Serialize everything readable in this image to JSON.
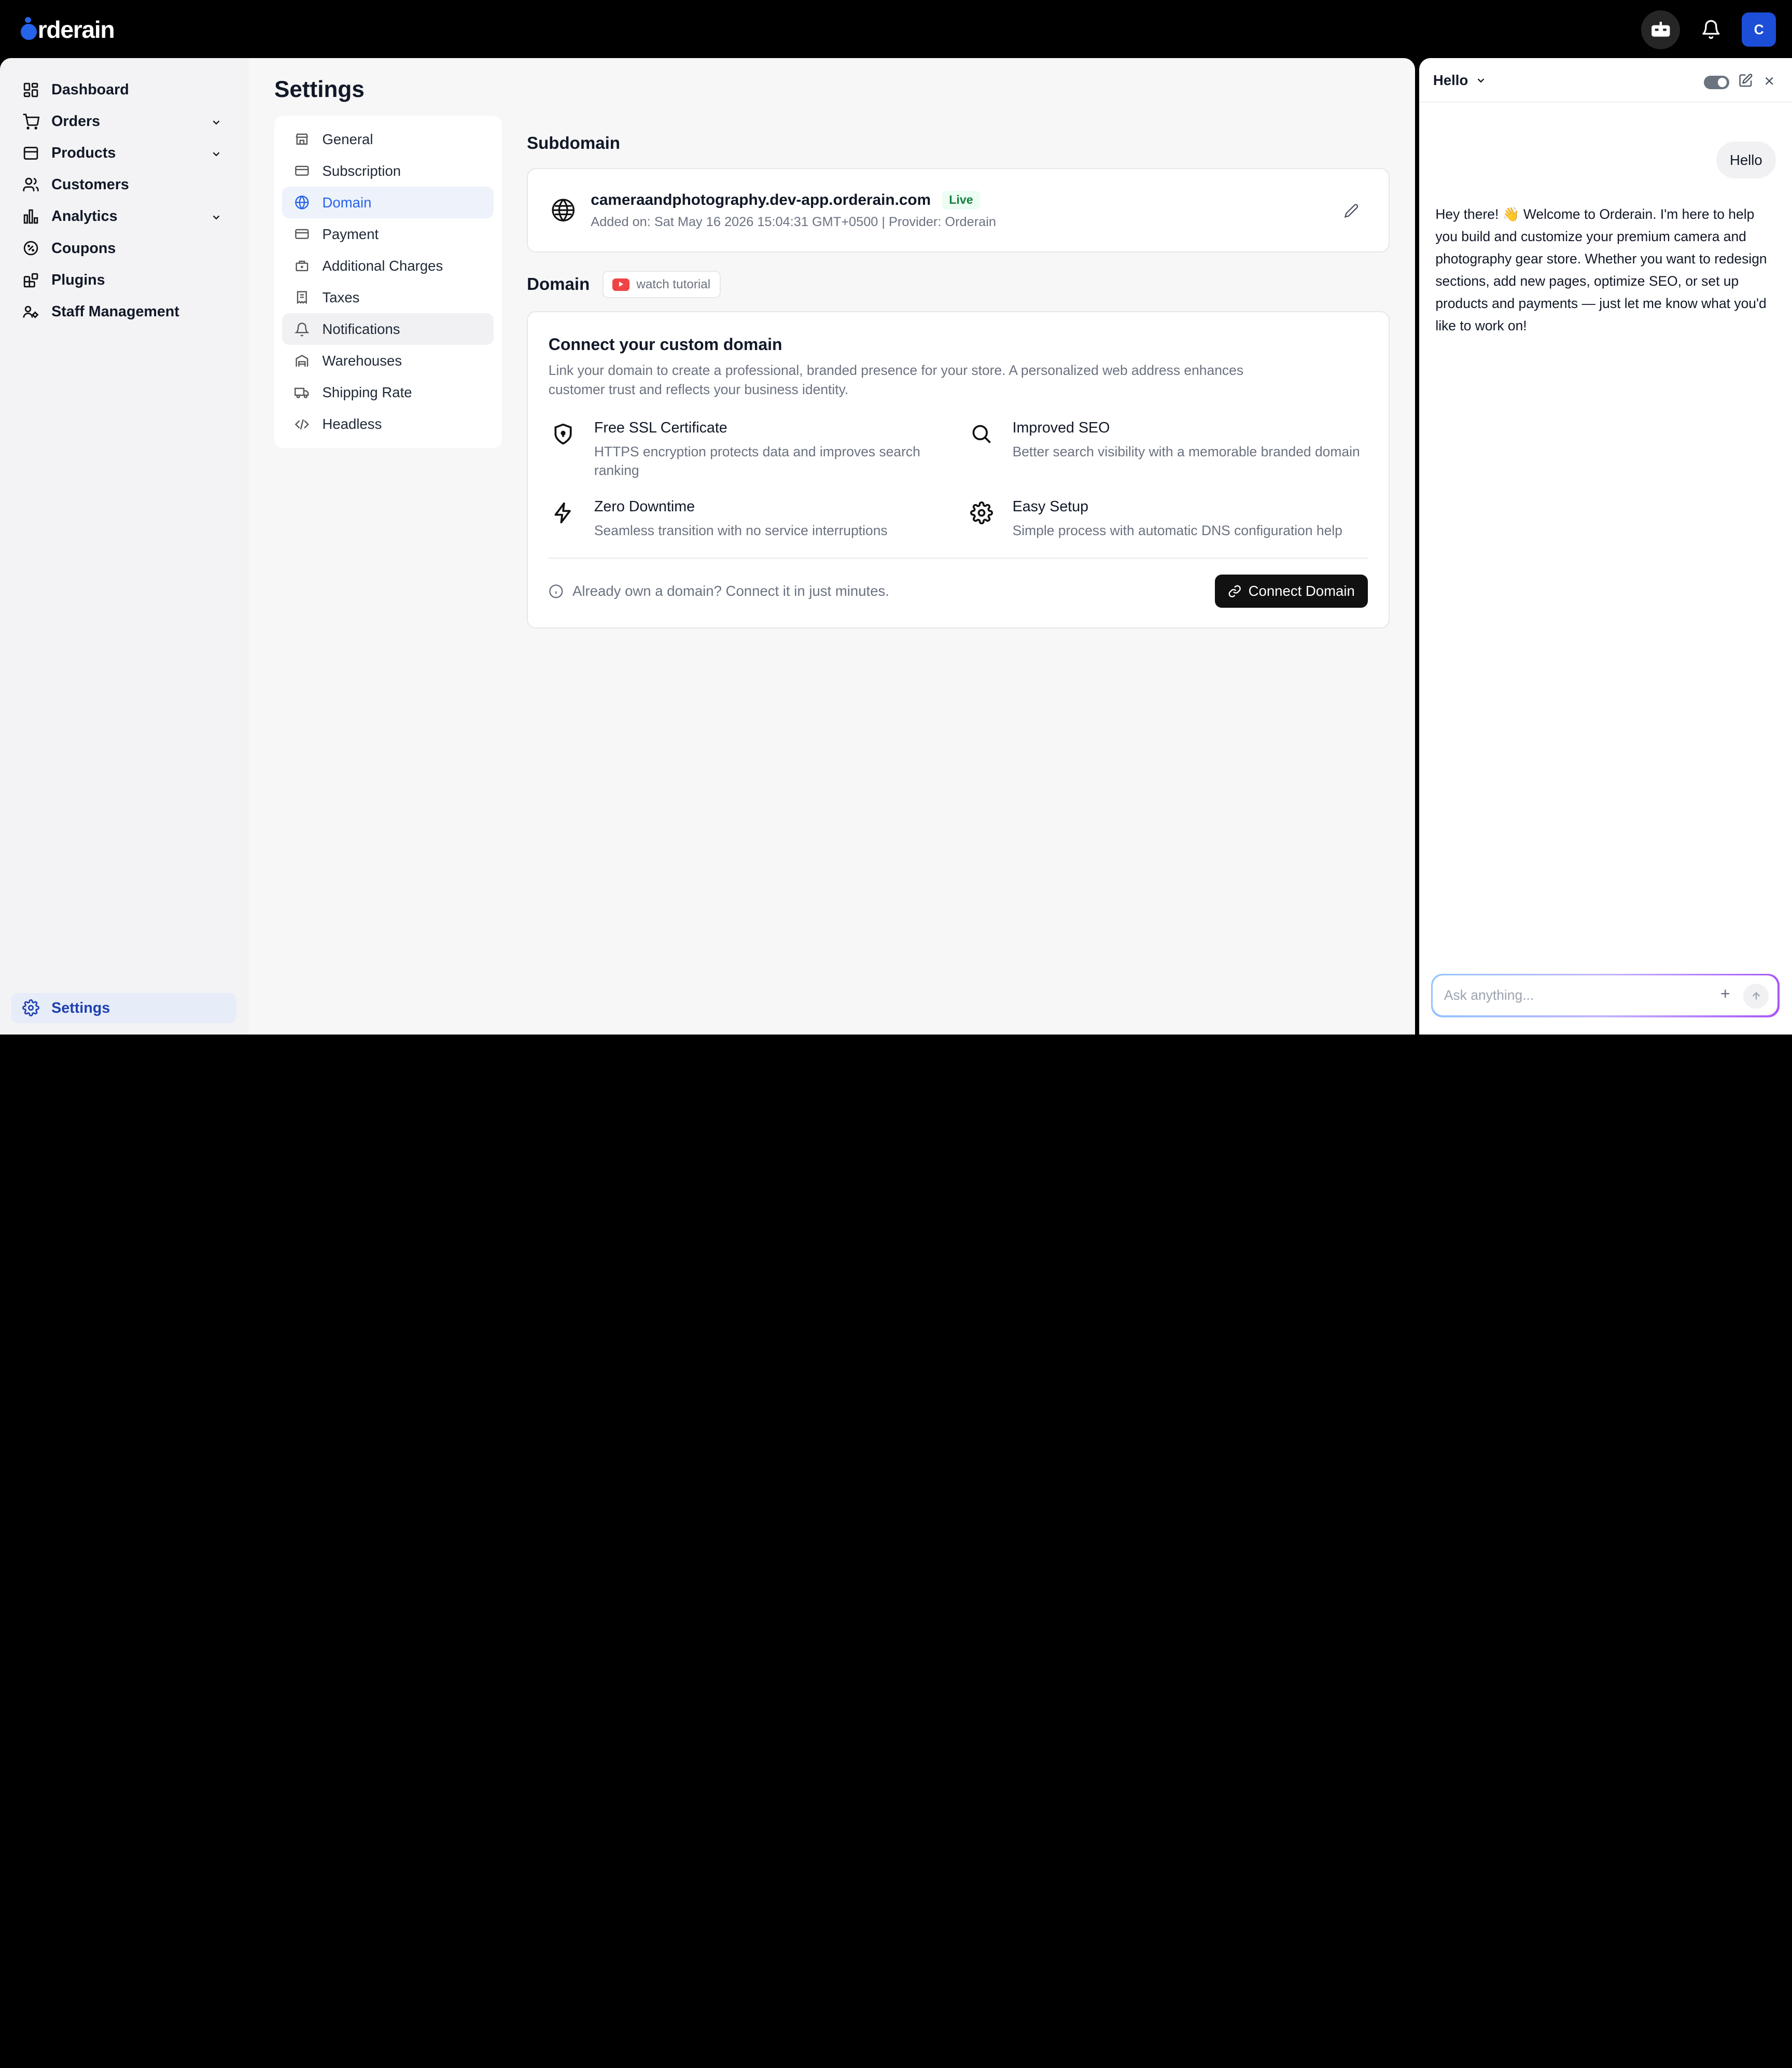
{
  "brand": {
    "logo_text": "rderain",
    "accent": "#2563eb"
  },
  "topbar": {
    "avatar_initial": "C"
  },
  "sidebar": {
    "items": [
      {
        "label": "Dashboard",
        "icon": "grid-icon"
      },
      {
        "label": "Orders",
        "icon": "cart-icon",
        "has_chevron": true
      },
      {
        "label": "Products",
        "icon": "box-icon",
        "has_chevron": true
      },
      {
        "label": "Customers",
        "icon": "users-icon"
      },
      {
        "label": "Analytics",
        "icon": "bar-chart-icon",
        "has_chevron": true
      },
      {
        "label": "Coupons",
        "icon": "percent-badge-icon"
      },
      {
        "label": "Plugins",
        "icon": "blocks-icon"
      },
      {
        "label": "Staff Management",
        "icon": "staff-icon"
      }
    ],
    "settings_label": "Settings"
  },
  "page": {
    "title": "Settings"
  },
  "settings_menu": {
    "items": [
      {
        "label": "General",
        "icon": "store-icon"
      },
      {
        "label": "Subscription",
        "icon": "card-icon"
      },
      {
        "label": "Domain",
        "icon": "globe-icon",
        "active": true
      },
      {
        "label": "Payment",
        "icon": "card-icon"
      },
      {
        "label": "Additional Charges",
        "icon": "charges-icon"
      },
      {
        "label": "Taxes",
        "icon": "receipt-icon"
      },
      {
        "label": "Notifications",
        "icon": "bell-icon"
      },
      {
        "label": "Warehouses",
        "icon": "warehouse-icon"
      },
      {
        "label": "Shipping Rate",
        "icon": "truck-icon"
      },
      {
        "label": "Headless",
        "icon": "code-icon"
      }
    ]
  },
  "subdomain": {
    "title": "Subdomain",
    "domain": "cameraandphotography.dev-app.orderain.com",
    "status": "Live",
    "meta": "Added on: Sat May 16 2026 15:04:31 GMT+0500 | Provider: Orderain"
  },
  "domain": {
    "title": "Domain",
    "tutorial_label": "watch tutorial",
    "card_title": "Connect your custom domain",
    "card_desc": "Link your domain to create a professional, branded presence for your store. A personalized web address enhances customer trust and reflects your business identity.",
    "features": [
      {
        "title": "Free SSL Certificate",
        "desc": "HTTPS encryption protects data and improves search ranking",
        "icon": "shield-icon"
      },
      {
        "title": "Improved SEO",
        "desc": "Better search visibility with a memorable branded domain",
        "icon": "search-icon"
      },
      {
        "title": "Zero Downtime",
        "desc": "Seamless transition with no service interruptions",
        "icon": "zap-icon"
      },
      {
        "title": "Easy Setup",
        "desc": "Simple process with automatic DNS configuration help",
        "icon": "gear-icon"
      }
    ],
    "hint": "Already own a domain? Connect it in just minutes.",
    "connect_label": "Connect Domain"
  },
  "chat": {
    "title": "Hello",
    "user_message": "Hello",
    "bot_message": "Hey there! 👋 Welcome to Orderain. I'm here to help you build and customize your premium camera and photography gear store. Whether you want to redesign sections, add new pages, optimize SEO, or set up products and payments — just let me know what you'd like to work on!",
    "input_placeholder": "Ask anything..."
  }
}
